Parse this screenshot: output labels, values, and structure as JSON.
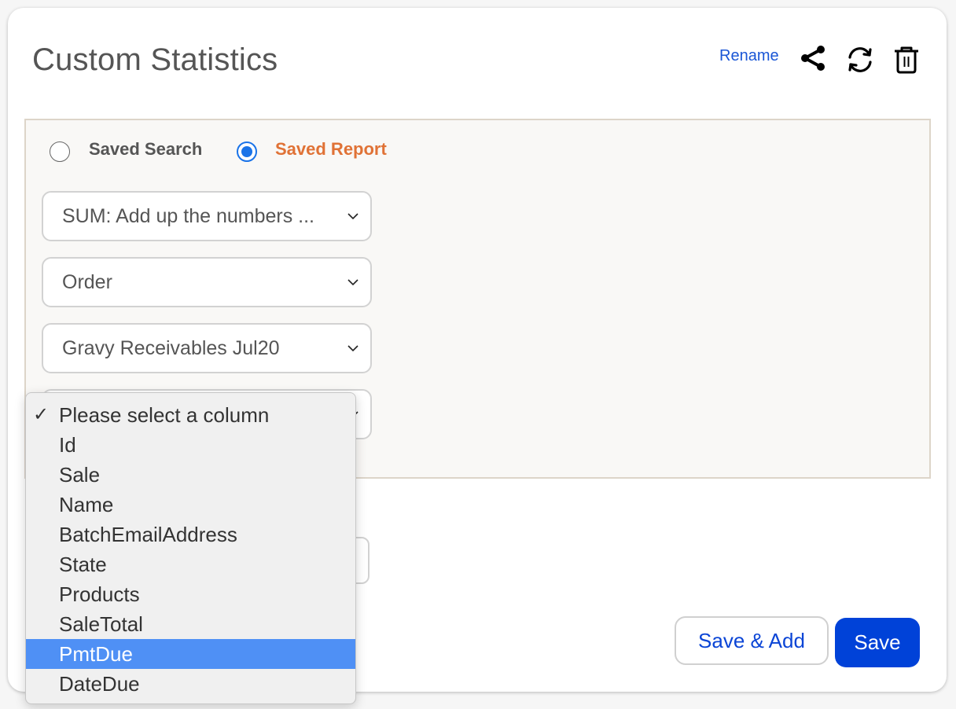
{
  "header": {
    "title": "Custom Statistics",
    "rename_label": "Rename",
    "icons": [
      "share-icon",
      "refresh-icon",
      "trash-icon"
    ]
  },
  "source_type": {
    "options": [
      {
        "label": "Saved Search",
        "selected": false
      },
      {
        "label": "Saved Report",
        "selected": true
      }
    ]
  },
  "selects": {
    "aggregation": "SUM: Add up the numbers ...",
    "object": "Order",
    "report": "Gravy Receivables Jul20",
    "column": "Please select a column"
  },
  "column_dropdown": {
    "checked_index": 0,
    "highlighted_index": 8,
    "options": [
      "Please select a column",
      "Id",
      "Sale",
      "Name",
      "BatchEmailAddress",
      "State",
      "Products",
      "SaleTotal",
      "PmtDue",
      "DateDue"
    ]
  },
  "buttons": {
    "save_add": "Save & Add",
    "save": "Save"
  },
  "colors": {
    "accent_blue": "#0042d8",
    "link_blue": "#1a56d6",
    "selected_label_orange": "#e07236",
    "highlight": "#4f90f5"
  }
}
